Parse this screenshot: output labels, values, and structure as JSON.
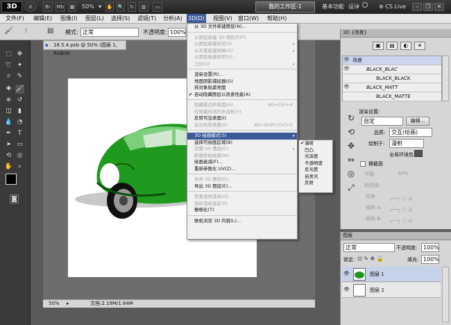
{
  "appbar": {
    "logo": "3D",
    "br": "Br",
    "mb": "Mb",
    "zoom": "50%",
    "workspace": "我的工作区-1",
    "basic": "基本功能",
    "design": "设计",
    "cslive": "CS Live"
  },
  "menubar": [
    "文件(F)",
    "编辑(E)",
    "图像(I)",
    "图层(L)",
    "选择(S)",
    "滤镜(T)",
    "分析(A)",
    "3D(D)",
    "视图(V)",
    "窗口(W)",
    "帮助(H)"
  ],
  "options": {
    "mode_label": "模式:",
    "mode_value": "正常",
    "opacity_label": "不透明度:",
    "opacity_value": "100%"
  },
  "document": {
    "tab": "18.5.4.psb @ 50% (图层 1, RGB/8)",
    "zoom": "50%",
    "doc_info": "文档:2.19M/1.64M"
  },
  "menu3d": {
    "items": [
      {
        "label": "从 3D 文件新建图层(N)...",
        "enabled": true
      },
      {
        "sep": true
      },
      {
        "label": "从图层新建 3D 明信片(P)",
        "enabled": false
      },
      {
        "label": "从图层新建形状(S)",
        "enabled": false,
        "sub": true
      },
      {
        "label": "从灰度新建网格(G)",
        "enabled": false,
        "sub": true
      },
      {
        "label": "从图层新建体积(V)...",
        "enabled": false
      },
      {
        "label": "凸纹(U)",
        "enabled": false,
        "sub": true
      },
      {
        "sep": true
      },
      {
        "label": "渲染设置(R)...",
        "enabled": true
      },
      {
        "label": "地面阴影捕捉器(G)",
        "enabled": true
      },
      {
        "label": "将对象贴紧地面",
        "enabled": true
      },
      {
        "label": "自动隐藏图层以改善性能(A)",
        "enabled": true,
        "checked": true
      },
      {
        "sep": true
      },
      {
        "label": "隐藏最近的表面(H)",
        "enabled": false,
        "shortcut": "Alt+Ctrl+X"
      },
      {
        "label": "仅隐藏封闭的多边形(Y)",
        "enabled": false
      },
      {
        "label": "反转可见表面(I)",
        "enabled": true
      },
      {
        "label": "显示所有表面(S)",
        "enabled": false,
        "shortcut": "Alt+Shift+Ctrl+X"
      },
      {
        "sep": true
      },
      {
        "label": "3D 绘画模式(3)",
        "enabled": true,
        "sub": true,
        "highlight": true
      },
      {
        "label": "选择可绘画区域(B)",
        "enabled": true
      },
      {
        "label": "创建 UV 叠加(C)",
        "enabled": false,
        "sub": true
      },
      {
        "label": "新建拼贴绘画(W)",
        "enabled": false
      },
      {
        "label": "绘画衰减(F)...",
        "enabled": true
      },
      {
        "label": "重新参数化 UV(Z)...",
        "enabled": true
      },
      {
        "sep": true
      },
      {
        "label": "合并 3D 图层(D)",
        "enabled": false
      },
      {
        "label": "导出 3D 图层(E)...",
        "enabled": true
      },
      {
        "sep": true
      },
      {
        "label": "恢复连续渲染(O)",
        "enabled": false
      },
      {
        "label": "连续渲染选区(P)",
        "enabled": false
      },
      {
        "label": "栅格化(T)",
        "enabled": true
      },
      {
        "sep": true
      },
      {
        "label": "联机浏览 3D 内容(L)...",
        "enabled": true
      }
    ]
  },
  "submenu": [
    {
      "label": "漫射",
      "checked": true
    },
    {
      "label": "凹凸"
    },
    {
      "label": "光泽度"
    },
    {
      "label": "不透明度"
    },
    {
      "label": "反光度"
    },
    {
      "label": "自发光"
    },
    {
      "label": "反射"
    }
  ],
  "panel3d": {
    "title": "3D {场景}",
    "tree": [
      "场景",
      "BLACK_BLAC",
      "BLACK_BLACK",
      "BLACK_MATT",
      "BLACK_MATTE"
    ],
    "render_label": "渲染设置:",
    "render_value": "自定",
    "edit_btn": "编辑...",
    "quality_label": "品质:",
    "quality_value": "交互(绘画)",
    "paint_label": "绘制于:",
    "paint_value": "漫射",
    "ambient_label": "全局环境色:",
    "cross_section": "横截面",
    "plane_label": "平面:",
    "plane_value": "50%",
    "intersect_label": "相交线:",
    "offset_label": "位移:",
    "tilt_a_label": "倾斜 A:",
    "tilt_b_label": "倾斜 B:"
  },
  "layers": {
    "title": "图层",
    "blend": "正常",
    "opacity_label": "不透明度:",
    "opacity_value": "100%",
    "lock_label": "锁定:",
    "fill_label": "填充:",
    "fill_value": "100%",
    "rows": [
      "图层 1",
      "图层 2"
    ]
  },
  "colors": {
    "accent": "#3b5a9a",
    "car": "#1f9a1f"
  }
}
